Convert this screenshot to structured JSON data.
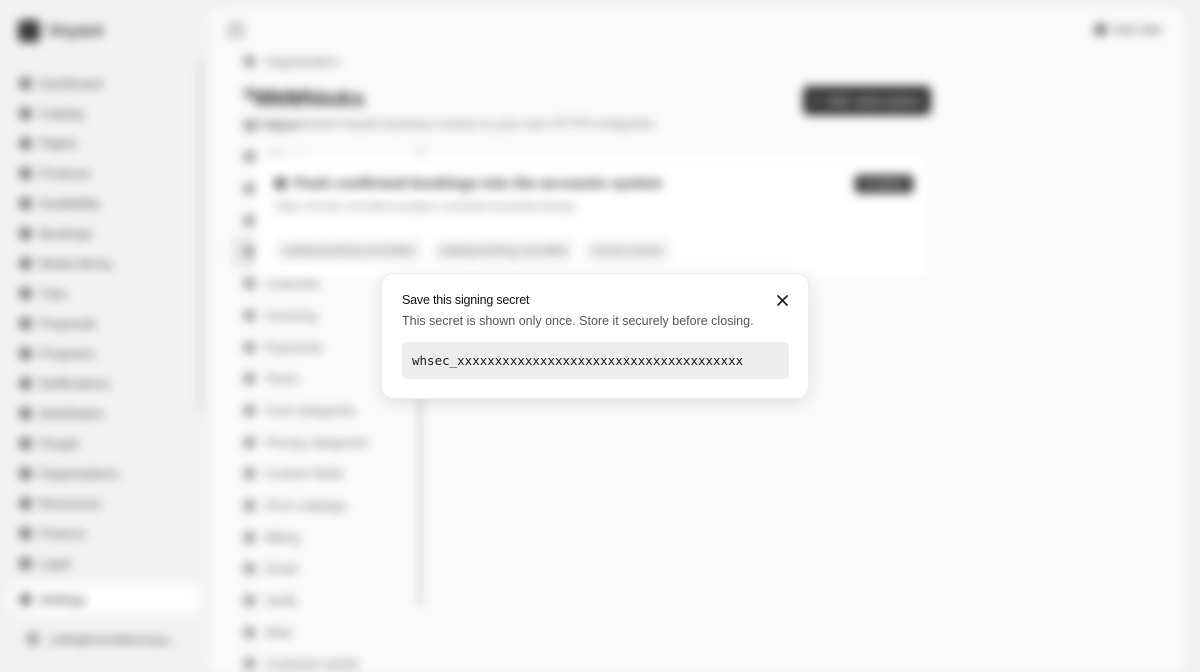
{
  "app": {
    "brand": "Voyant",
    "visit_site": "Visit Site"
  },
  "sidebar": {
    "items": [
      {
        "label": "Dashboard"
      },
      {
        "label": "Catalog"
      },
      {
        "label": "Flights"
      },
      {
        "label": "Products"
      },
      {
        "label": "Availability"
      },
      {
        "label": "Bookings"
      },
      {
        "label": "Media library"
      },
      {
        "label": "Trips"
      },
      {
        "label": "Proposals"
      },
      {
        "label": "Programs"
      },
      {
        "label": "Notifications"
      },
      {
        "label": "Distribution"
      },
      {
        "label": "People"
      },
      {
        "label": "Organizations"
      },
      {
        "label": "Resources"
      },
      {
        "label": "Finance"
      },
      {
        "label": "Legal"
      }
    ],
    "settings": "Settings",
    "user_email": "sofia@meridianvoya..."
  },
  "settings_nav": {
    "items": [
      {
        "label": "Organization"
      },
      {
        "label": "Navigation"
      },
      {
        "label": "Team"
      },
      {
        "label": "API tokens"
      },
      {
        "label": "MCP"
      },
      {
        "label": "Markets"
      },
      {
        "label": "Webhooks"
      },
      {
        "label": "Channels"
      },
      {
        "label": "Invoicing"
      },
      {
        "label": "Payments"
      },
      {
        "label": "Taxes"
      },
      {
        "label": "Cost categories"
      },
      {
        "label": "Pricing categories"
      },
      {
        "label": "Custom fields"
      },
      {
        "label": "Price catalogs"
      },
      {
        "label": "Billing"
      },
      {
        "label": "Email"
      },
      {
        "label": "Verify"
      },
      {
        "label": "Web"
      },
      {
        "label": "Customer portal"
      }
    ]
  },
  "page": {
    "title": "Webhooks",
    "subtitle": "Send selected Voyant business events to your own HTTPS endpoints.",
    "add_button": "Add subscription"
  },
  "subscription": {
    "title": "Push confirmed bookings into the accounts system",
    "url": "https://hooks.meridianvoyages.example/voyant/bookings",
    "status": "Enabled",
    "tags": [
      "catalog.booking.committed",
      "catalog.booking.cancelled",
      "invoice.issued"
    ]
  },
  "dialog": {
    "title": "Save this signing secret",
    "description": "This secret is shown only once. Store it securely before closing.",
    "secret": "whsec_xxxxxxxxxxxxxxxxxxxxxxxxxxxxxxxxxxxxxx"
  }
}
